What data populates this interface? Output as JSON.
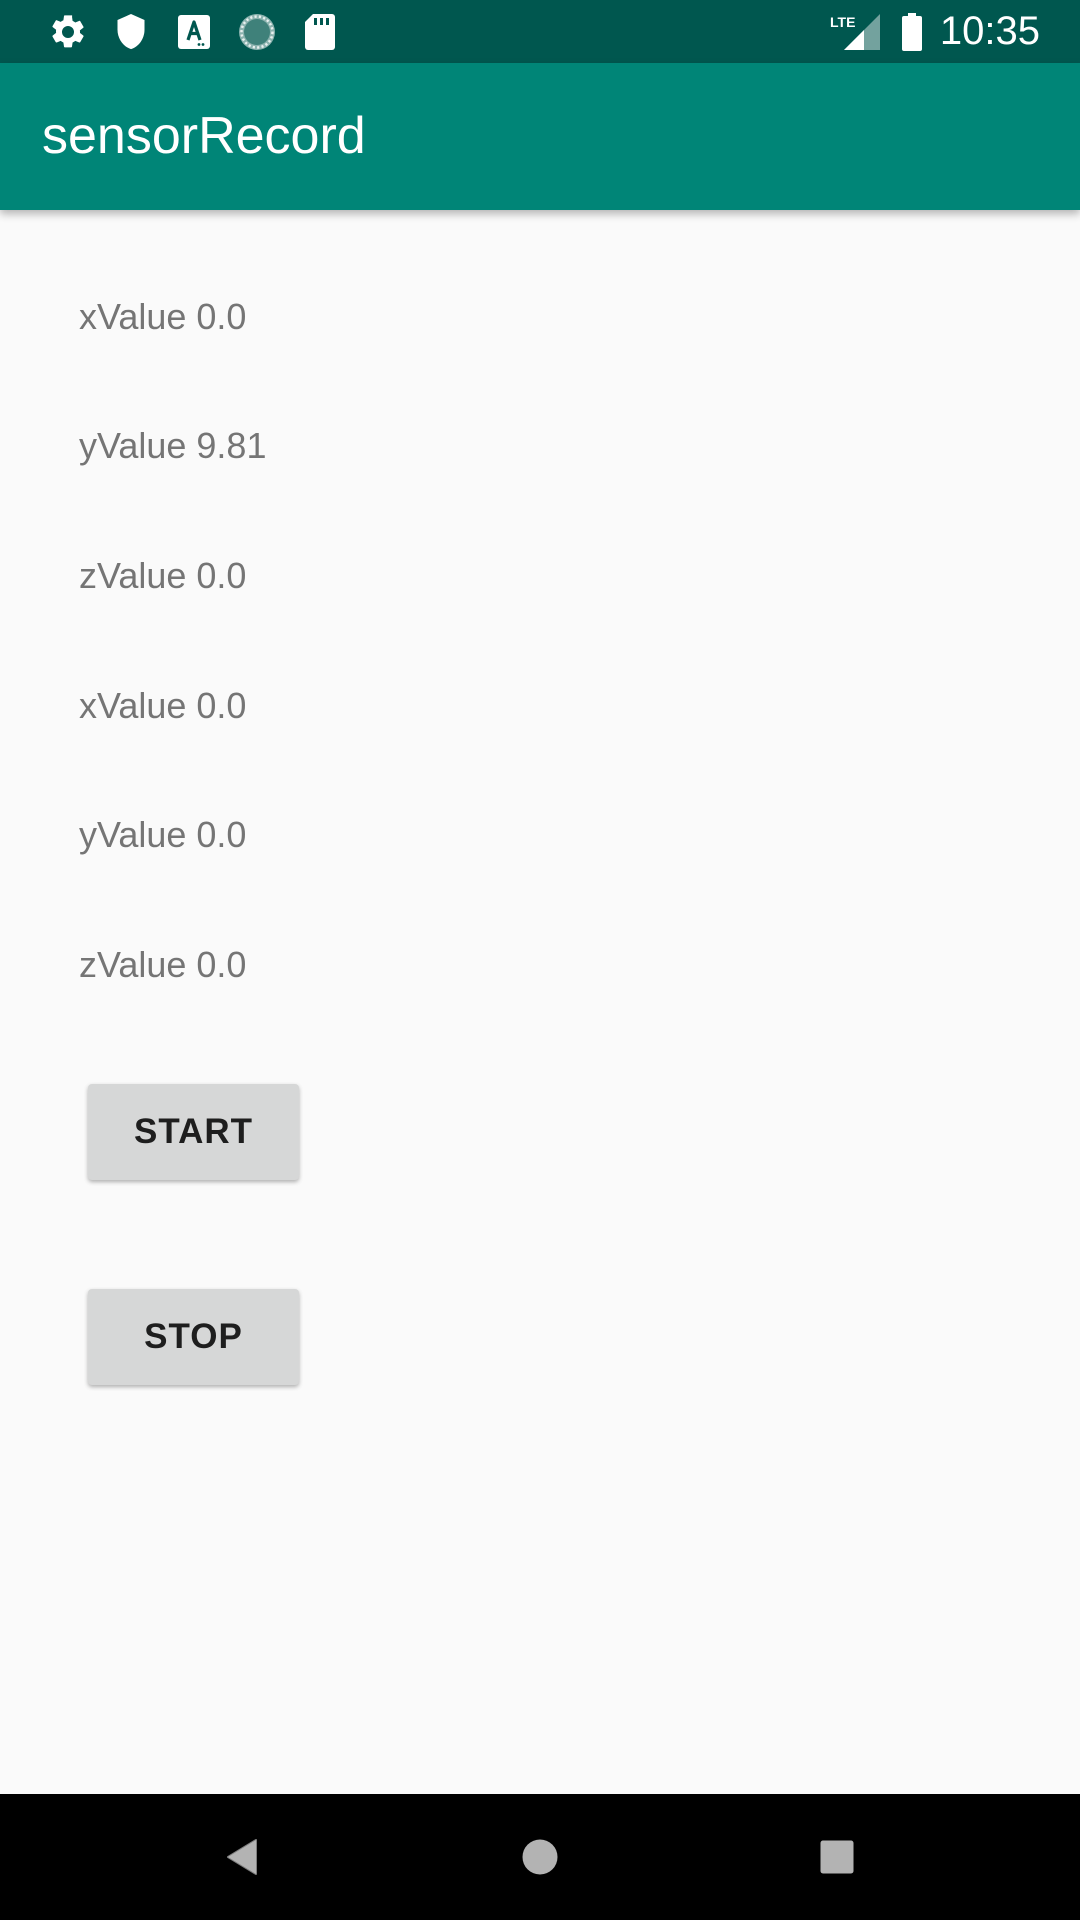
{
  "status_bar": {
    "time": "10:35",
    "network": "LTE",
    "icons": [
      "settings-icon",
      "shield-icon",
      "text-a-icon",
      "sync-icon",
      "sd-card-icon",
      "lte-signal-icon",
      "battery-icon"
    ]
  },
  "app_bar": {
    "title": "sensorRecord"
  },
  "readings": [
    {
      "text": "xValue 0.0"
    },
    {
      "text": "yValue 9.81"
    },
    {
      "text": "zValue 0.0"
    },
    {
      "text": "xValue 0.0"
    },
    {
      "text": "yValue 0.0"
    },
    {
      "text": "zValue 0.0"
    }
  ],
  "buttons": {
    "start_label": "START",
    "stop_label": "STOP"
  },
  "nav": {
    "icons": [
      "back-icon",
      "home-icon",
      "recents-icon"
    ]
  },
  "colors": {
    "status_bar": "#00574f",
    "app_bar": "#008577",
    "background": "#fafafa",
    "button": "#d6d7d7",
    "reading_text": "#757575"
  }
}
